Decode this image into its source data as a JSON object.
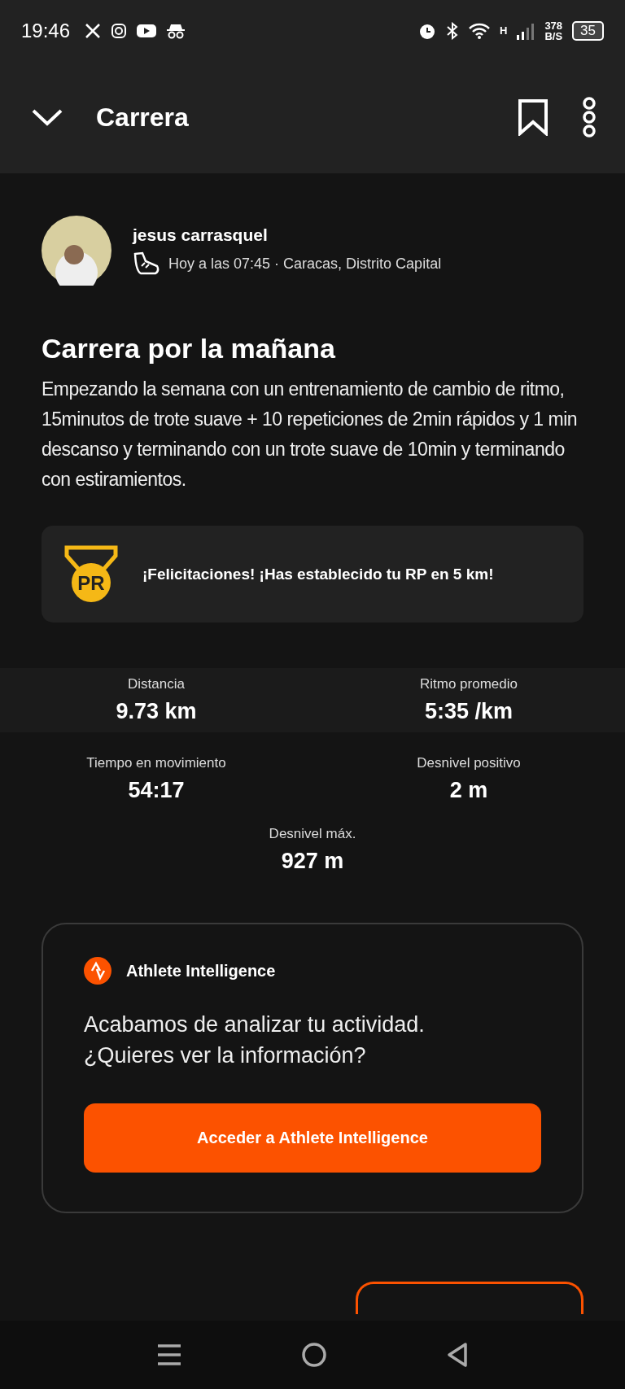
{
  "status_bar": {
    "time": "19:46",
    "network_type": "H",
    "speed": "378",
    "speed_unit": "B/S",
    "battery": "35"
  },
  "header": {
    "title": "Carrera"
  },
  "athlete": {
    "name": "jesus carrasquel",
    "meta": "Hoy a las 07:45 · Caracas, Distrito Capital"
  },
  "activity": {
    "title": "Carrera por la mañana",
    "description": "Empezando la semana con un entrenamiento de cambio de ritmo, 15minutos de trote suave + 10 repeticiones de 2min rápidos y 1 min descanso y terminando con un trote suave de 10min y terminando con estiramientos."
  },
  "achievement": {
    "badge": "PR",
    "text": "¡Felicitaciones! ¡Has establecido tu RP en 5 km!"
  },
  "stats": [
    {
      "label": "Distancia",
      "value": "9.73 km",
      "highlighted": true
    },
    {
      "label": "Ritmo promedio",
      "value": "5:35 /km",
      "highlighted": true
    },
    {
      "label": "Tiempo en movimiento",
      "value": "54:17",
      "highlighted": false
    },
    {
      "label": "Desnivel positivo",
      "value": "2 m",
      "highlighted": false
    },
    {
      "label": "Desnivel máx.",
      "value": "927 m",
      "highlighted": false
    }
  ],
  "insight_card": {
    "title": "Athlete Intelligence",
    "message": "Acabamos de analizar tu actividad. ¿Quieres ver la información?",
    "button": "Acceder a Athlete Intelligence"
  }
}
